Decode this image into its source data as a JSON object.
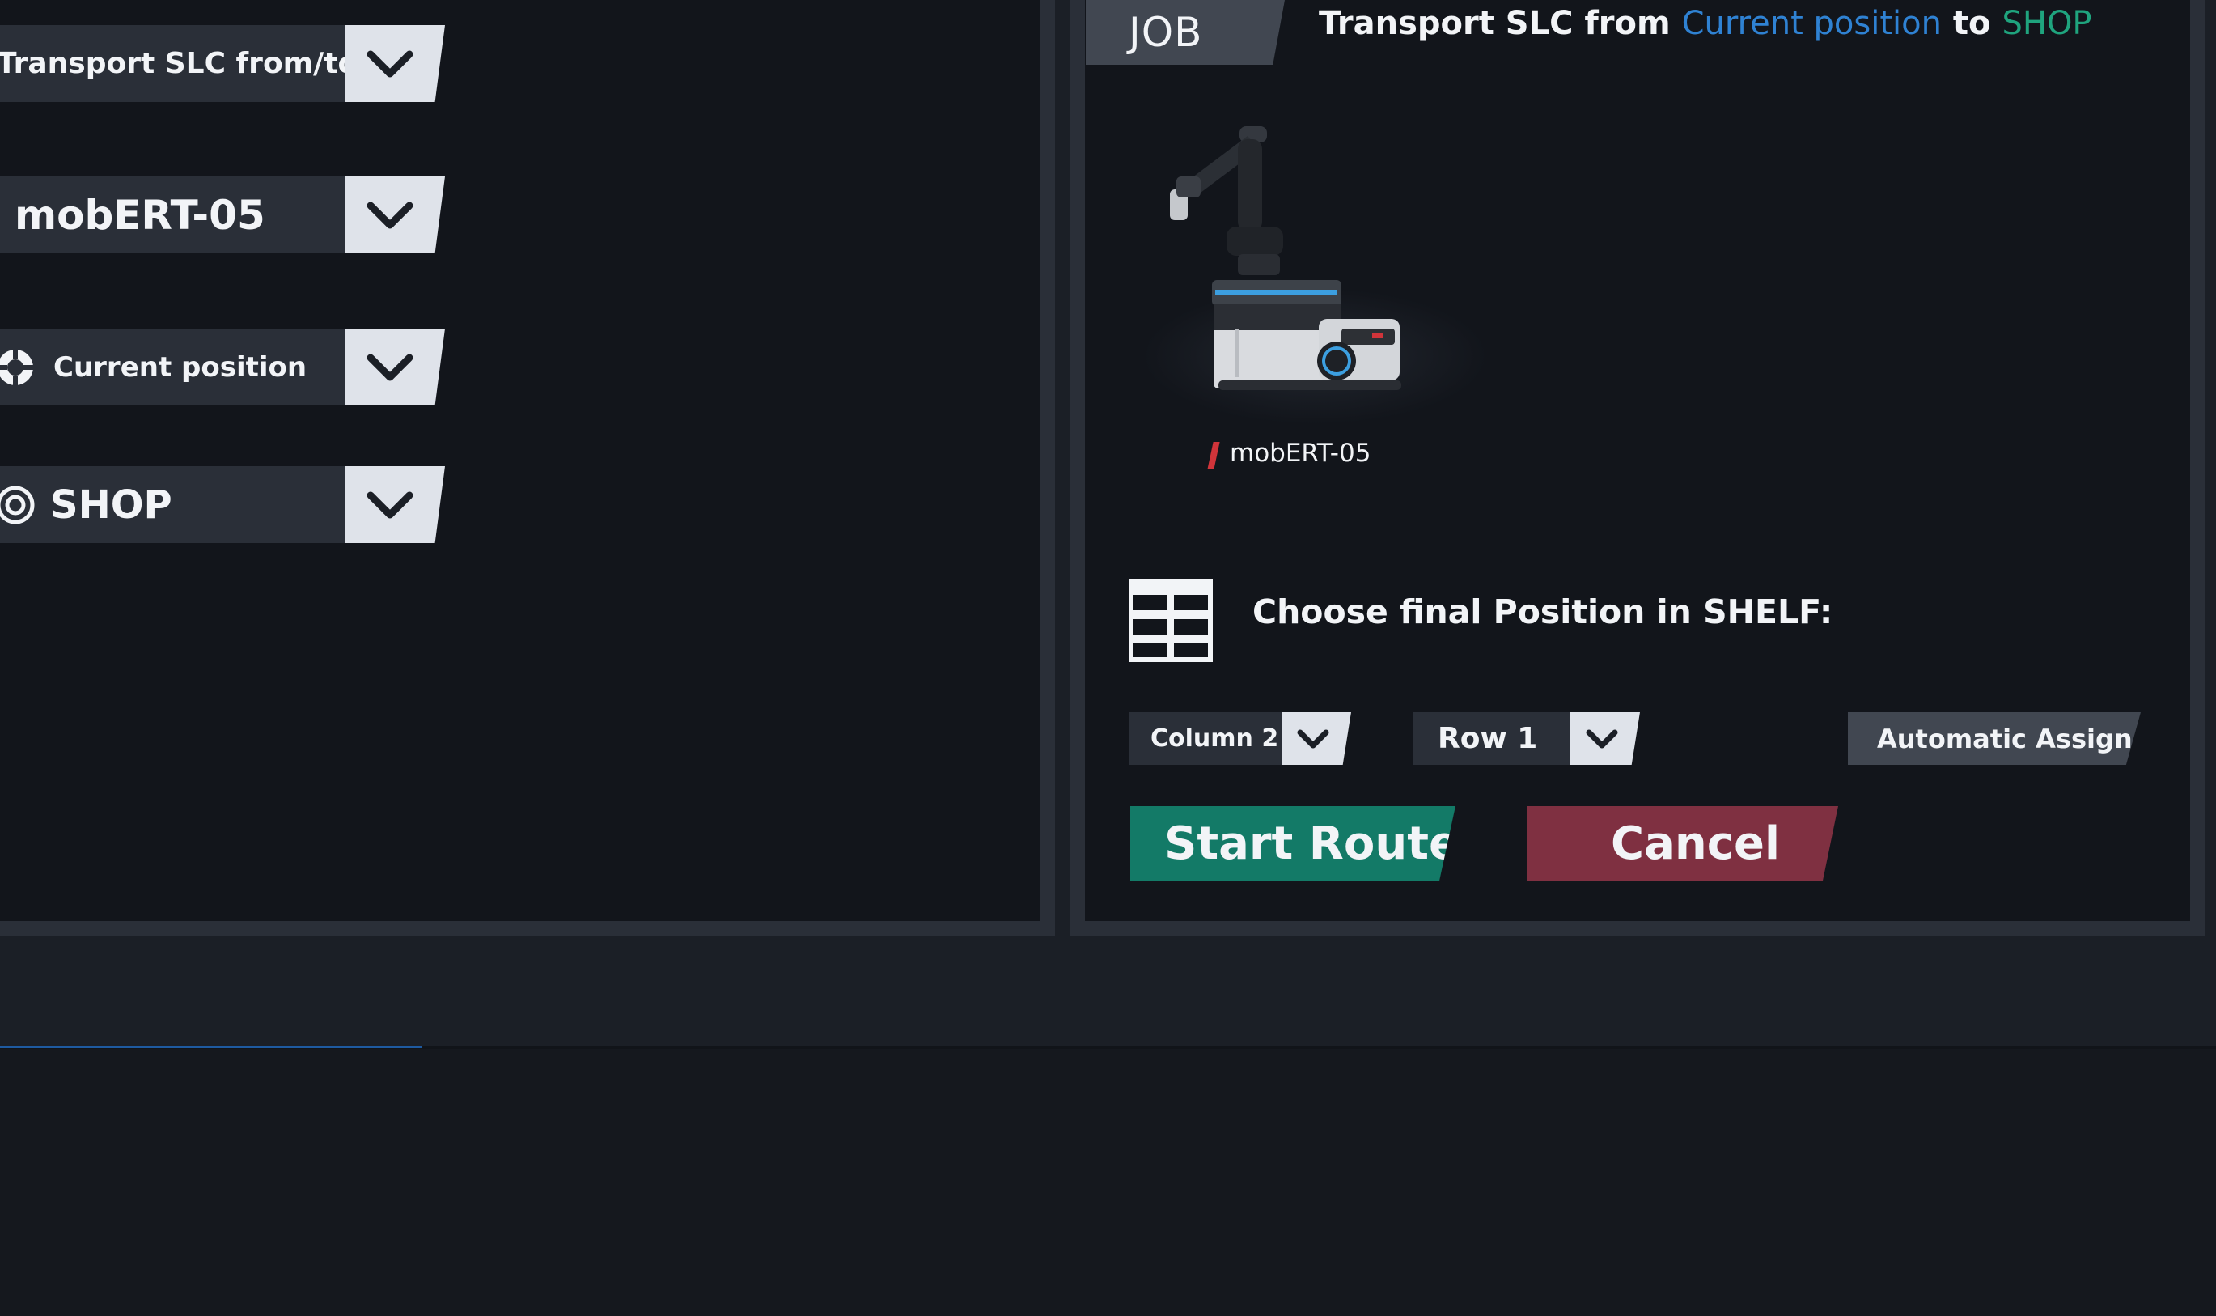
{
  "left_panel": {
    "job_type": {
      "value": "Transport SLC from/to",
      "icon": "chevron-down-icon"
    },
    "robot": {
      "value": "mobERT-05",
      "icon": "chevron-down-icon"
    },
    "from": {
      "value": "Current position",
      "icon": "crosshair-icon"
    },
    "to": {
      "value": "SHOP",
      "icon": "target-icon"
    }
  },
  "job": {
    "tab_label": "JOB",
    "title_prefix": "Transport SLC from",
    "from": "Current position",
    "connector": "to",
    "to": "SHOP",
    "robot_name": "mobERT-05",
    "shelf_prompt": "Choose final Position in SHELF:",
    "column": "Column 2",
    "row": "Row 1",
    "automatic_assign": "Automatic Assign",
    "start_route": "Start Route",
    "cancel": "Cancel"
  },
  "colors": {
    "from_highlight": "#2f82d3",
    "to_highlight": "#1fa47e",
    "start_button": "#137a67",
    "cancel_button": "#7f3041",
    "robot_marker": "#d0343a"
  }
}
